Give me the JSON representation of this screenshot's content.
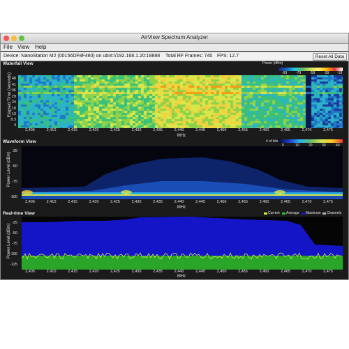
{
  "window": {
    "title": "AirView Spectrum Analyzer"
  },
  "menu": [
    "File",
    "View",
    "Help"
  ],
  "status": {
    "device": "Device: NanoStation M2 (00156DF8F460) on ubnt://192.168.1.20:18888",
    "frames": "Total RF Frames: 740",
    "fps": "FPS: 12.7",
    "reset_label": "Reset All Data"
  },
  "x_ticks": [
    "2,405",
    "2,410",
    "2,415",
    "2,420",
    "2,425",
    "2,430",
    "2,435",
    "2,440",
    "2,445",
    "2,450",
    "2,455",
    "2,460",
    "2,465",
    "2,470",
    "2,475"
  ],
  "x_label": "MHz",
  "waterfall": {
    "title": "Waterfall View",
    "ylabel": "Elapsed Time (seconds)",
    "yticks": [
      "48",
      "41",
      "36",
      "29",
      "24",
      "18",
      "13",
      "8.3",
      "4"
    ],
    "legend_title": "Power (dBm)",
    "legend_ticks": [
      "-99",
      "-79",
      "-59",
      "-39",
      "-19"
    ]
  },
  "waveform": {
    "title": "Waveform View",
    "ylabel": "Power Level (dBm)",
    "yticks": [
      "-25",
      "-50",
      "-75",
      "-100"
    ],
    "legend_title": "# of hits",
    "legend_ticks": [
      "0",
      "10",
      "20",
      "30",
      "40"
    ]
  },
  "realtime": {
    "title": "Real-time View",
    "ylabel": "Power Level (dBm)",
    "yticks": [
      "-25",
      "-50",
      "-75",
      "-100",
      "-125"
    ],
    "legend": [
      {
        "label": "Current",
        "color": "#d8e84a"
      },
      {
        "label": "Average",
        "color": "#2fbf2f"
      },
      {
        "label": "Maximum",
        "color": "#1515c8"
      },
      {
        "label": "Channels",
        "color": "#b0b0b0"
      }
    ]
  },
  "colors": {
    "background": "#1b1b1b",
    "maximum_fill": "#1515c8",
    "average_fill": "#2aa52a",
    "current_line": "#d8e84a"
  }
}
